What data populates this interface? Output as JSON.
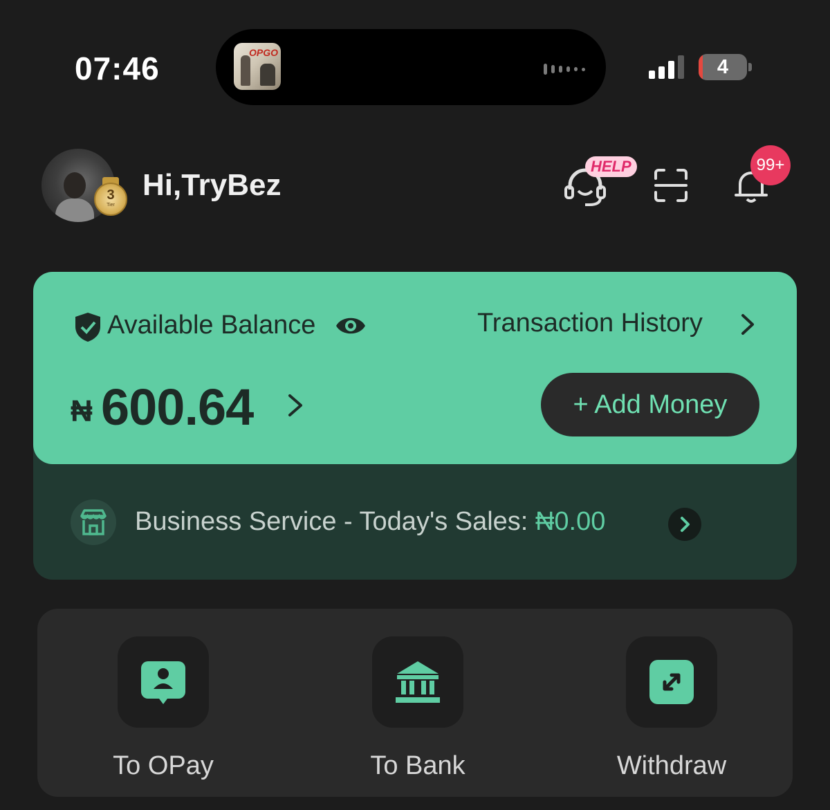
{
  "status_bar": {
    "time": "07:46",
    "battery_level": "4",
    "now_playing_art_text": "OPGO"
  },
  "header": {
    "greeting": "Hi,TryBez",
    "tier_number": "3",
    "tier_label": "Tier",
    "help_badge": "HELP",
    "notification_count": "99+"
  },
  "balance_card": {
    "label": "Available Balance",
    "history_link": "Transaction History",
    "currency_symbol": "₦",
    "amount": "600.64",
    "add_money_label": "+ Add Money",
    "background": "#5fcda3"
  },
  "business": {
    "text": "Business Service - Today's Sales: ",
    "amount": "₦0.00"
  },
  "actions": [
    {
      "label": "To OPay",
      "icon": "person-chat-icon"
    },
    {
      "label": "To Bank",
      "icon": "bank-icon"
    },
    {
      "label": "Withdraw",
      "icon": "withdraw-arrows-icon"
    }
  ],
  "colors": {
    "background": "#1c1c1c",
    "accent": "#5fcda3",
    "badge": "#e8395f"
  }
}
